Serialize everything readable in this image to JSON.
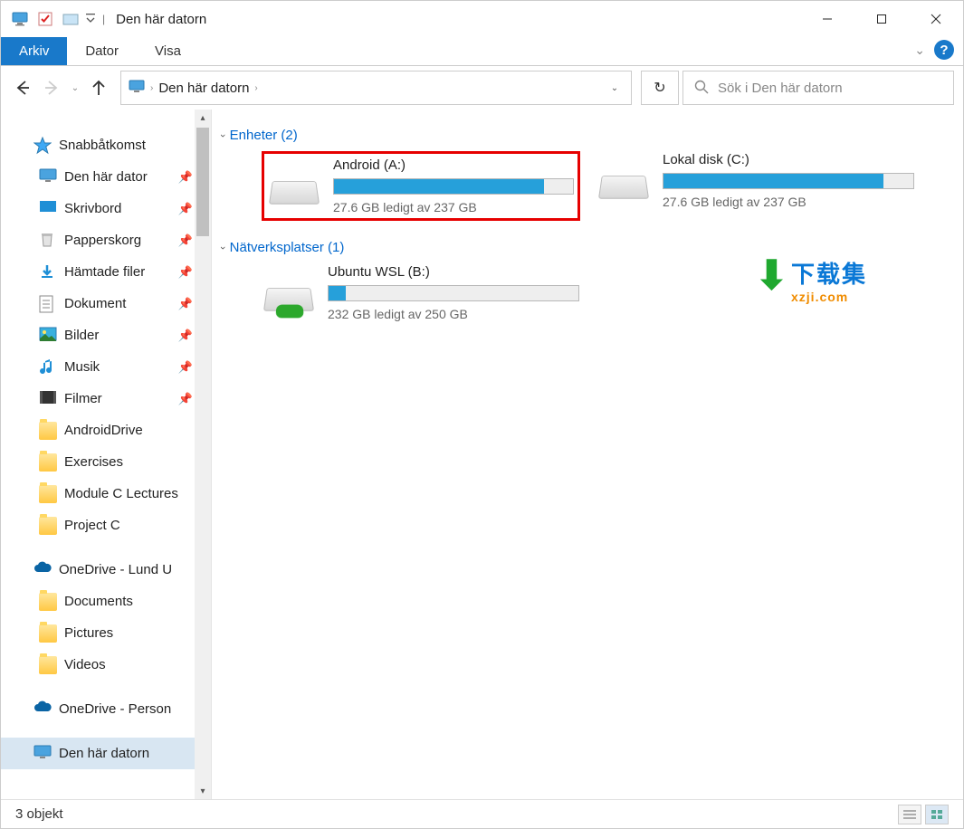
{
  "window": {
    "title": "Den här datorn"
  },
  "ribbon": {
    "file": "Arkiv",
    "tabs": [
      "Dator",
      "Visa"
    ]
  },
  "address": {
    "crumb": "Den här datorn",
    "search_placeholder": "Sök i Den här datorn"
  },
  "sidebar": {
    "quick_access": "Snabbåtkomst",
    "items_pinned": [
      {
        "label": "Den här dator",
        "icon": "pc"
      },
      {
        "label": "Skrivbord",
        "icon": "desktop"
      },
      {
        "label": "Papperskorg",
        "icon": "trash"
      },
      {
        "label": "Hämtade filer",
        "icon": "download"
      },
      {
        "label": "Dokument",
        "icon": "doc"
      },
      {
        "label": "Bilder",
        "icon": "picture"
      },
      {
        "label": "Musik",
        "icon": "music"
      },
      {
        "label": "Filmer",
        "icon": "film"
      }
    ],
    "items_folders": [
      {
        "label": "AndroidDrive"
      },
      {
        "label": "Exercises"
      },
      {
        "label": "Module C Lectures"
      },
      {
        "label": "Project C"
      }
    ],
    "onedrive1": "OneDrive - Lund U",
    "onedrive1_items": [
      "Documents",
      "Pictures",
      "Videos"
    ],
    "onedrive2": "OneDrive - Person",
    "this_pc": "Den här datorn"
  },
  "sections": {
    "devices": "Enheter (2)",
    "network": "Nätverksplatser (1)"
  },
  "drives": [
    {
      "name": "Android (A:)",
      "free": "27.6 GB ledigt av 237 GB",
      "fill": 88,
      "highlight": true,
      "kind": "hdd"
    },
    {
      "name": "Lokal disk (C:)",
      "free": "27.6 GB ledigt av 237 GB",
      "fill": 88,
      "highlight": false,
      "kind": "hdd"
    }
  ],
  "network_drives": [
    {
      "name": "Ubuntu WSL (B:)",
      "free": "232 GB ledigt av 250 GB",
      "fill": 7,
      "kind": "net"
    }
  ],
  "status": {
    "text": "3 objekt"
  },
  "watermark": {
    "line1": "下载集",
    "line2": "xzji.com"
  }
}
